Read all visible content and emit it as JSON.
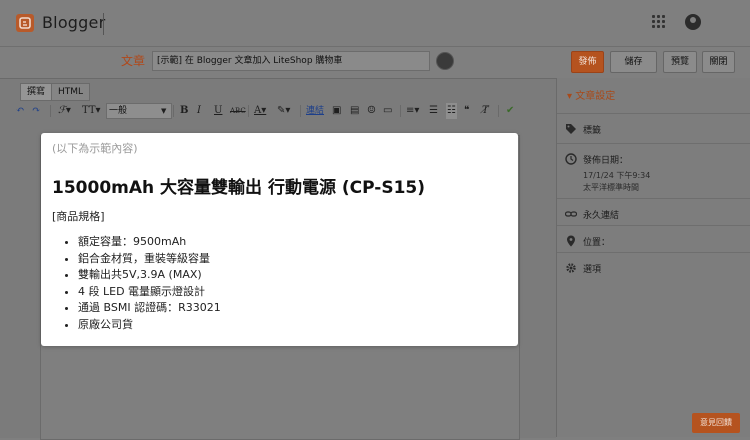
{
  "header": {
    "brand": "Blogger"
  },
  "post": {
    "title_label": "文章",
    "title_value": "[示範] 在 Blogger 文章加入 LiteShop 購物車"
  },
  "actions": {
    "publish": "發佈",
    "save": "儲存",
    "preview": "預覽",
    "close": "關閉"
  },
  "editor": {
    "mode_compose": "撰寫",
    "mode_html": "HTML",
    "font_size_select": "一般",
    "link_label": "連結"
  },
  "content": {
    "demo_note": "(以下為示範內容)",
    "heading": "15000mAh 大容量雙輸出 行動電源 (CP-S15)",
    "spec_label": "[商品規格]",
    "specs": [
      "額定容量：9500mAh",
      "鋁合金材質，重裝等級容量",
      "雙輸出共5V,3.9A (MAX)",
      "4 段 LED 電量顯示燈設計",
      "通過 BSMI 認證碼：R33021",
      "原廠公司貨"
    ]
  },
  "sidebar": {
    "heading": "文章設定",
    "labels": "標籤",
    "publish_date_label": "發佈日期：",
    "publish_date_value": "17/1/24 下午9:34",
    "timezone": "太平洋標準時間",
    "permalink": "永久連結",
    "location": "位置：",
    "options": "選項"
  },
  "feedback": "意見回饋",
  "colors": {
    "accent": "#b5531f",
    "overlay": "#7f7f7f",
    "card": "#ffffff"
  }
}
